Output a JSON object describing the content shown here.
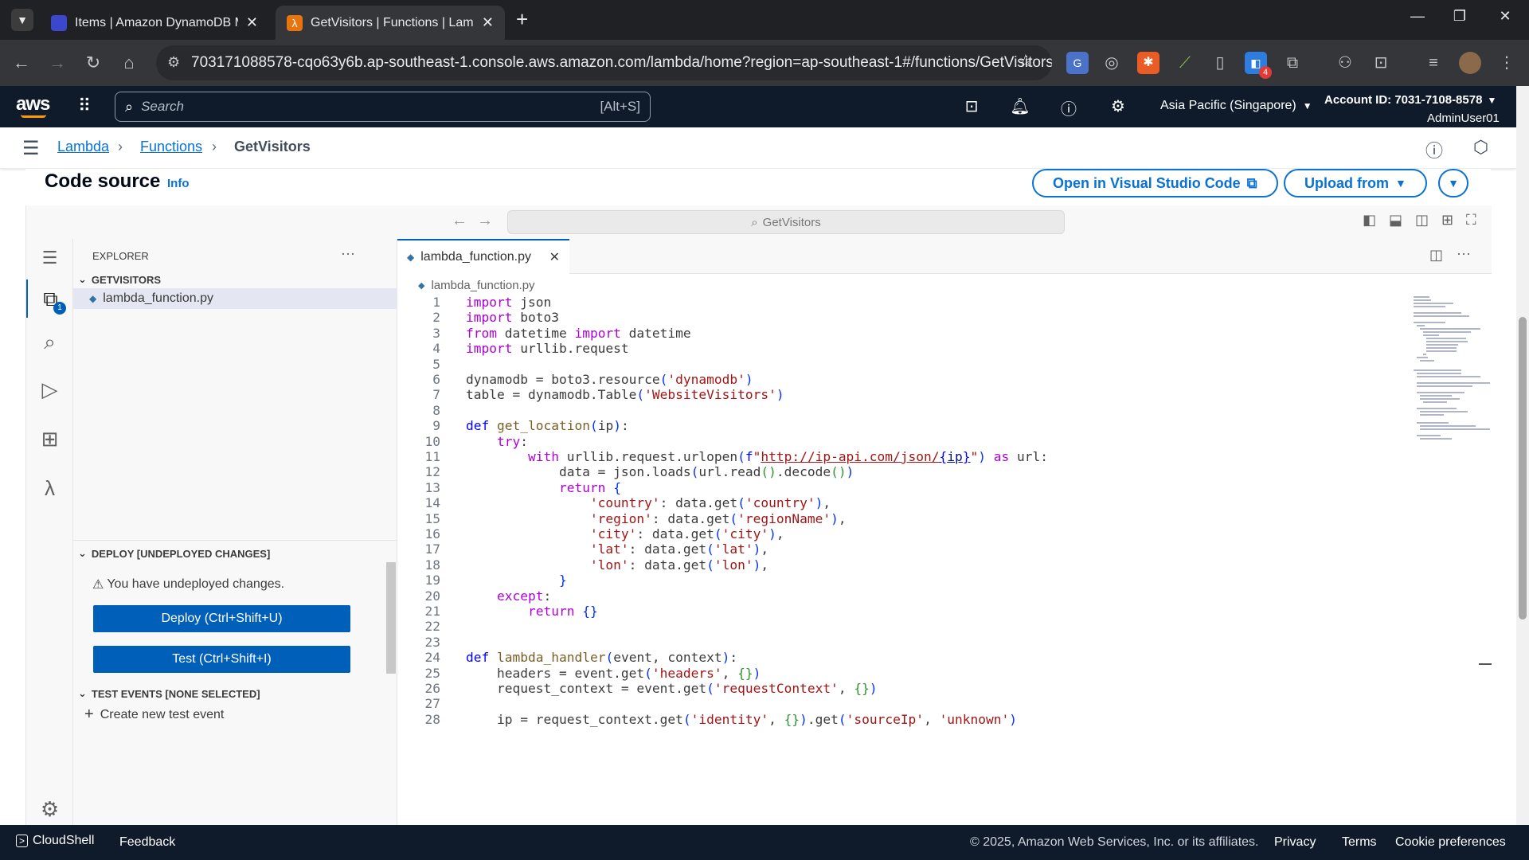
{
  "browser": {
    "tabs": [
      {
        "title": "Items | Amazon DynamoDB Ma",
        "active": false
      },
      {
        "title": "GetVisitors | Functions | Lambda",
        "active": true
      }
    ],
    "url": "703171088578-cqo63y6b.ap-southeast-1.console.aws.amazon.com/lambda/home?region=ap-southeast-1#/functions/GetVisitors?...",
    "extension_badge": "4"
  },
  "aws_header": {
    "logo": "aws",
    "search_placeholder": "Search",
    "search_shortcut": "[Alt+S]",
    "region": "Asia Pacific (Singapore)",
    "account": "Account ID: 7031-7108-8578",
    "user": "AdminUser01"
  },
  "breadcrumb": [
    "Lambda",
    "Functions",
    "GetVisitors"
  ],
  "code_source": {
    "title": "Code source",
    "info": "Info",
    "open_vscode": "Open in Visual Studio Code",
    "upload_from": "Upload from"
  },
  "ide": {
    "command_center": "GetVisitors",
    "explorer_title": "EXPLORER",
    "folder": "GETVISITORS",
    "file": "lambda_function.py",
    "explorer_badge": "1",
    "deploy_section": "DEPLOY [UNDEPLOYED CHANGES]",
    "undeployed_msg": "You have undeployed changes.",
    "deploy_button": "Deploy (Ctrl+Shift+U)",
    "test_button": "Test (Ctrl+Shift+I)",
    "test_events_section": "TEST EVENTS [NONE SELECTED]",
    "create_test_event": "Create new test event",
    "editor_tab": "lambda_function.py",
    "editor_breadcrumb": "lambda_function.py"
  },
  "code_lines": [
    "import json",
    "import boto3",
    "from datetime import datetime",
    "import urllib.request",
    "",
    "dynamodb = boto3.resource('dynamodb')",
    "table = dynamodb.Table('WebsiteVisitors')",
    "",
    "def get_location(ip):",
    "    try:",
    "        with urllib.request.urlopen(f\"http://ip-api.com/json/{ip}\") as url:",
    "            data = json.loads(url.read().decode())",
    "            return {",
    "                'country': data.get('country'),",
    "                'region': data.get('regionName'),",
    "                'city': data.get('city'),",
    "                'lat': data.get('lat'),",
    "                'lon': data.get('lon'),",
    "            }",
    "    except:",
    "        return {}",
    "",
    "",
    "def lambda_handler(event, context):",
    "    headers = event.get('headers', {})",
    "    request_context = event.get('requestContext', {})",
    "",
    "    ip = request_context.get('identity', {}).get('sourceIp', 'unknown')"
  ],
  "footer": {
    "cloudshell": "CloudShell",
    "feedback": "Feedback",
    "copyright": "© 2025, Amazon Web Services, Inc. or its affiliates.",
    "privacy": "Privacy",
    "terms": "Terms",
    "cookies": "Cookie preferences"
  },
  "colors": {
    "aws_nav": "#0f1b2a",
    "link": "#0972d3",
    "vscode_blue": "#005fb8"
  }
}
